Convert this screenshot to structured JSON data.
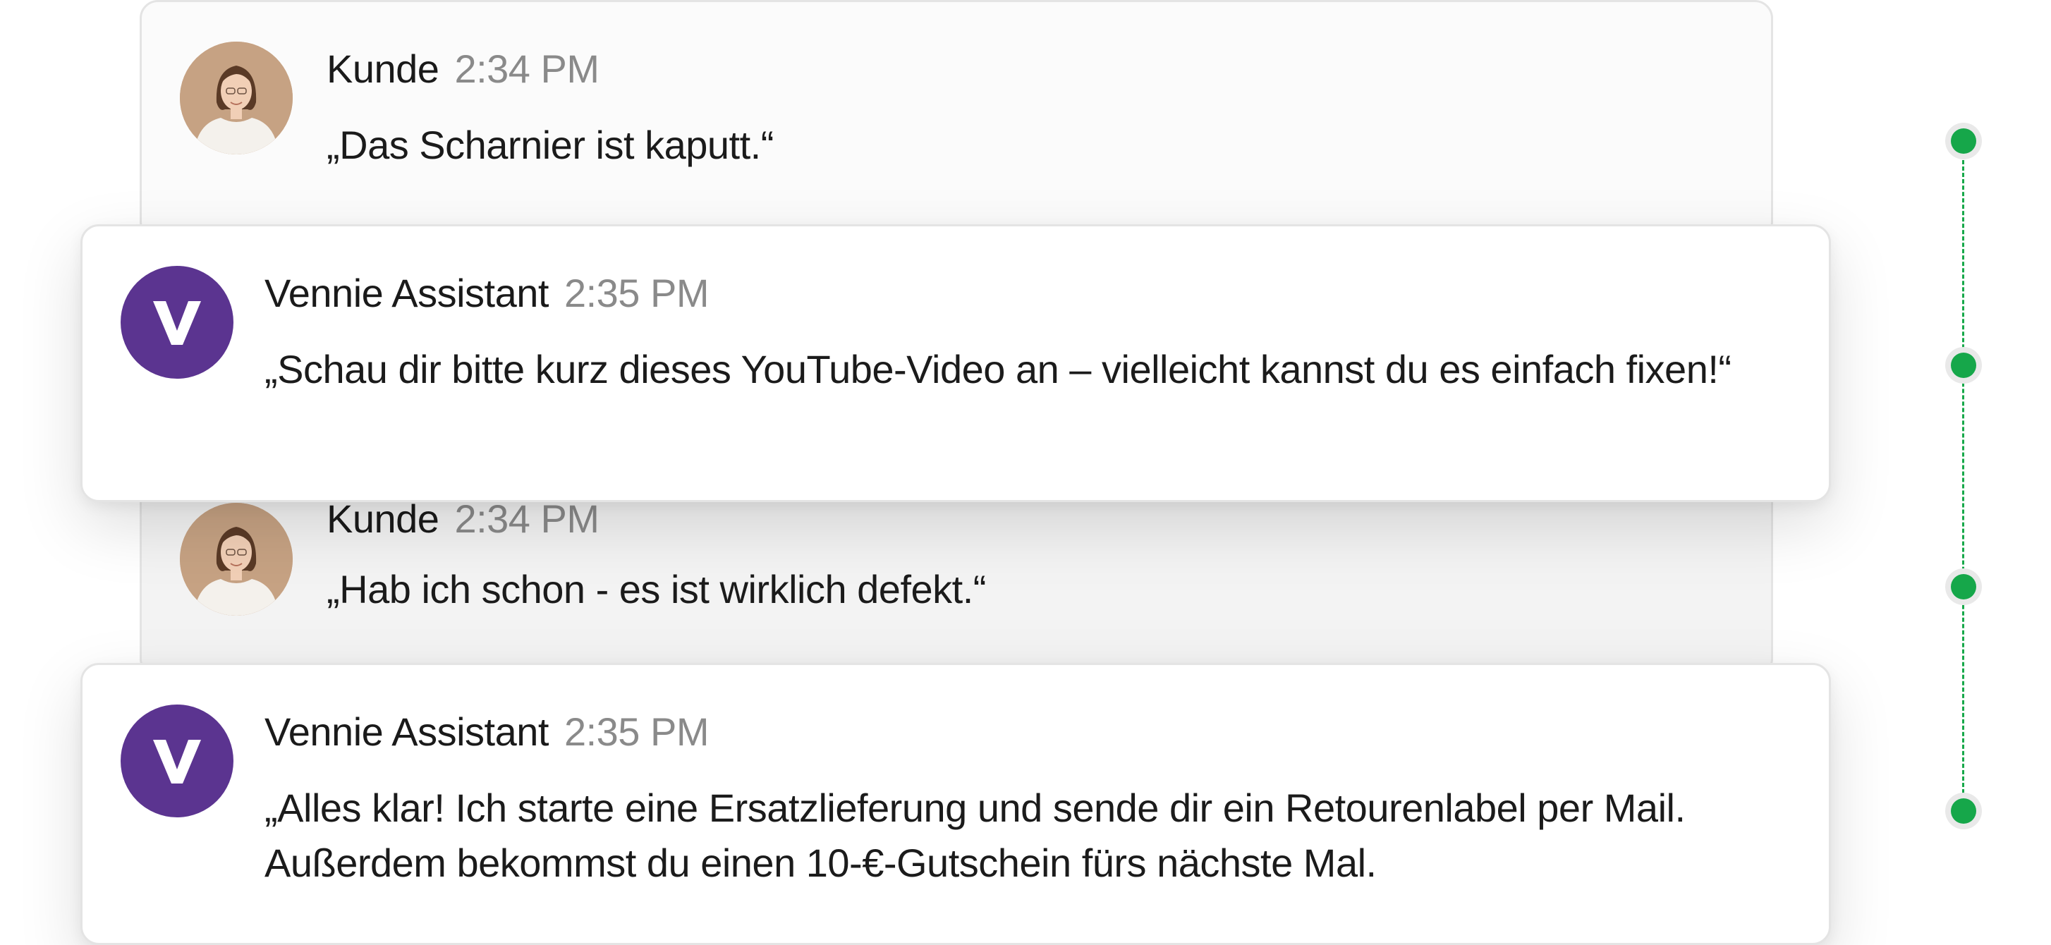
{
  "messages": [
    {
      "sender": "Kunde",
      "time": "2:34 PM",
      "text": [
        "„Das Scharnier ist kaputt.“"
      ],
      "avatar_icon": "customer-photo-avatar"
    },
    {
      "sender": "Vennie Assistant",
      "time": "2:35 PM",
      "text": [
        "„Schau dir bitte kurz dieses YouTube-Video an – vielleicht kannst du es einfach fixen!“"
      ],
      "avatar_icon": "vennie-logo-avatar",
      "avatar_letter": "V"
    },
    {
      "sender": "Kunde",
      "time": "2:34 PM",
      "text": [
        "„Hab ich schon - es ist wirklich defekt.“"
      ],
      "avatar_icon": "customer-photo-avatar"
    },
    {
      "sender": "Vennie Assistant",
      "time": "2:35 PM",
      "text": [
        "„Alles klar! Ich starte eine Ersatzlieferung und sende dir ein Retourenlabel per Mail.",
        "Außerdem bekommst du einen 10-€-Gutschein fürs nächste Mal."
      ],
      "avatar_icon": "vennie-logo-avatar",
      "avatar_letter": "V"
    }
  ],
  "colors": {
    "brand_purple": "#5b3490",
    "timeline_green": "#16a74a",
    "time_gray": "#8a8a8a"
  },
  "timeline": {
    "steps": 4
  }
}
